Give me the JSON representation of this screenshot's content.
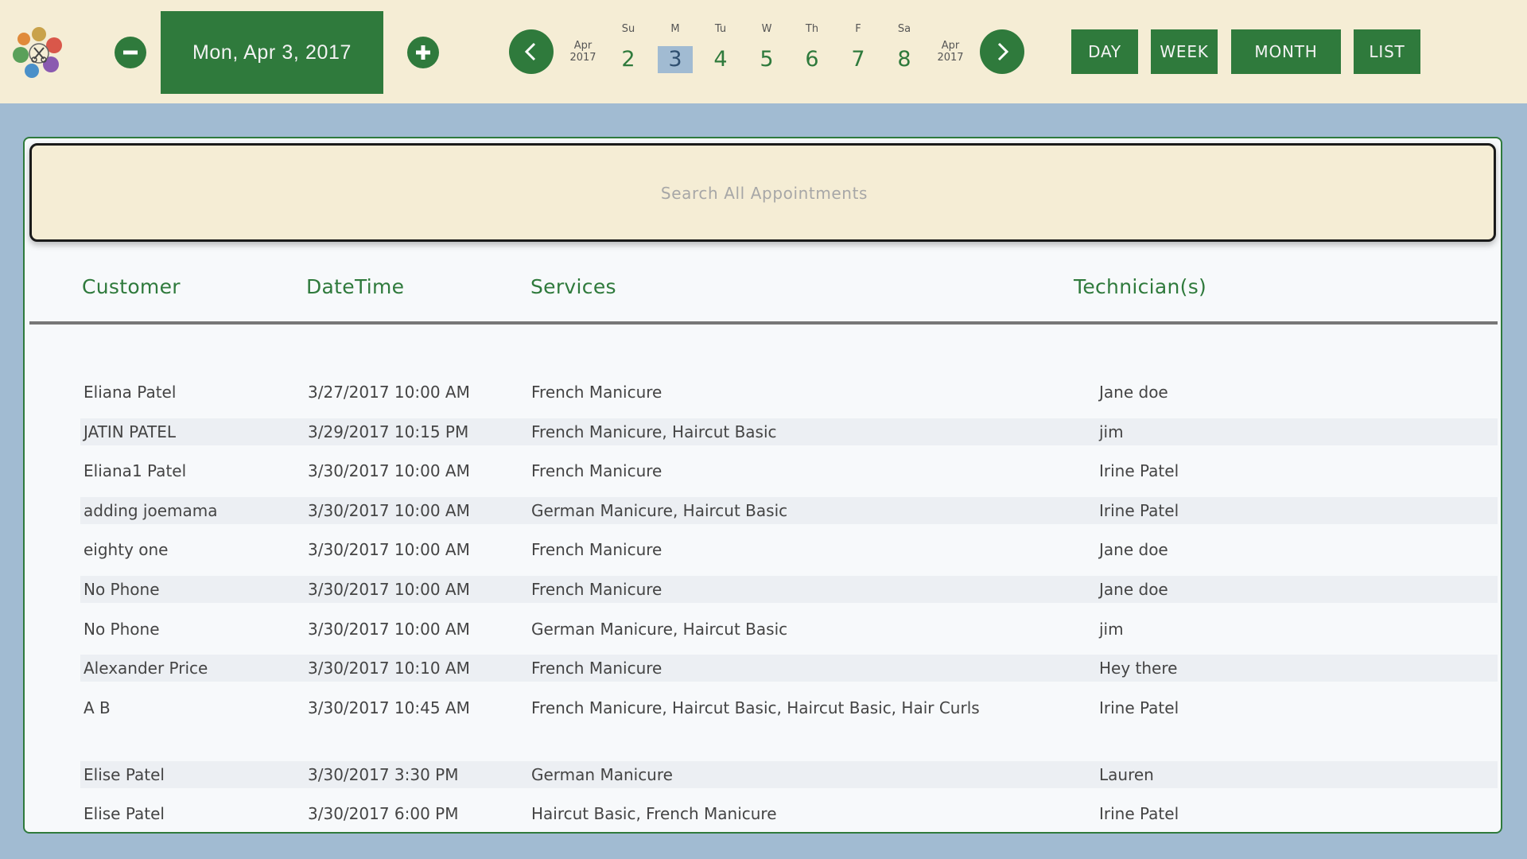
{
  "header": {
    "current_date": "Mon, Apr 3, 2017",
    "week_left_month": "Apr",
    "week_left_year": "2017",
    "week_right_month": "Apr",
    "week_right_year": "2017",
    "days": [
      {
        "abbr": "Su",
        "num": "2"
      },
      {
        "abbr": "M",
        "num": "3"
      },
      {
        "abbr": "Tu",
        "num": "4"
      },
      {
        "abbr": "W",
        "num": "5"
      },
      {
        "abbr": "Th",
        "num": "6"
      },
      {
        "abbr": "F",
        "num": "7"
      },
      {
        "abbr": "Sa",
        "num": "8"
      }
    ],
    "selected_day": "3",
    "views": {
      "day": "DAY",
      "week": "WEEK",
      "month": "MONTH",
      "list": "LIST"
    }
  },
  "search": {
    "placeholder": "Search All Appointments",
    "value": ""
  },
  "table": {
    "columns": {
      "customer": "Customer",
      "datetime": "DateTime",
      "services": "Services",
      "technicians": "Technician(s)"
    },
    "rows": [
      {
        "customer": "Eliana Patel",
        "datetime": "3/27/2017 10:00 AM",
        "services": "French Manicure",
        "technicians": "Jane doe"
      },
      {
        "customer": "JATIN PATEL",
        "datetime": "3/29/2017 10:15 PM",
        "services": "French Manicure, Haircut Basic",
        "technicians": "jim"
      },
      {
        "customer": "Eliana1 Patel",
        "datetime": "3/30/2017 10:00 AM",
        "services": "French Manicure",
        "technicians": "Irine Patel"
      },
      {
        "customer": "adding joemama",
        "datetime": "3/30/2017 10:00 AM",
        "services": "German Manicure, Haircut Basic",
        "technicians": "Irine Patel"
      },
      {
        "customer": "eighty one",
        "datetime": "3/30/2017 10:00 AM",
        "services": "French Manicure",
        "technicians": "Jane doe"
      },
      {
        "customer": "No Phone",
        "datetime": "3/30/2017 10:00 AM",
        "services": "French Manicure",
        "technicians": "Jane doe"
      },
      {
        "customer": "No Phone",
        "datetime": "3/30/2017 10:00 AM",
        "services": "German Manicure, Haircut Basic",
        "technicians": "jim"
      },
      {
        "customer": "Alexander Price",
        "datetime": "3/30/2017 10:10 AM",
        "services": "French Manicure",
        "technicians": "Hey there"
      },
      {
        "customer": "A B",
        "datetime": "3/30/2017 10:45 AM",
        "services": "French Manicure, Haircut Basic, Haircut Basic, Hair Curls",
        "technicians": "Irine Patel"
      },
      {
        "customer": "Elise Patel",
        "datetime": "3/30/2017 3:30 PM",
        "services": "German Manicure",
        "technicians": "Lauren"
      },
      {
        "customer": "Elise Patel",
        "datetime": "3/30/2017 6:00 PM",
        "services": "Haircut Basic, French Manicure",
        "technicians": "Irine Patel"
      }
    ]
  },
  "colors": {
    "brand_green": "#2f7a3c",
    "cream": "#f5edd5",
    "page_blue": "#a1bbd2"
  },
  "icons": [
    "salon-logo-icon",
    "minus-icon",
    "plus-icon",
    "chevron-left-icon",
    "chevron-right-icon"
  ]
}
